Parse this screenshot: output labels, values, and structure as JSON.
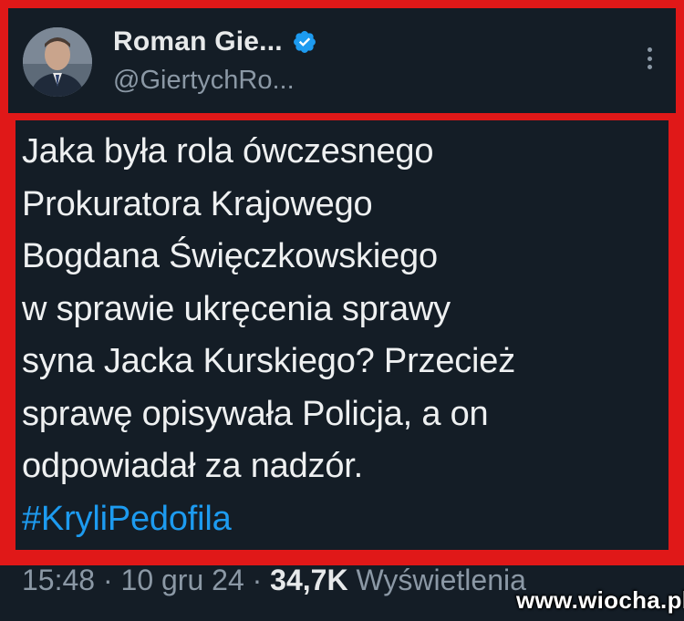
{
  "author": {
    "display_name": "Roman Gie...",
    "handle": "@GiertychRo...",
    "verified_icon": "verified-badge-icon",
    "avatar_icon": "profile-photo"
  },
  "tweet": {
    "lines": [
      "Jaka była rola ówczesnego",
      "Prokuratora Krajowego",
      "Bogdana Święczkowskiego",
      "w sprawie ukręcenia sprawy",
      "syna Jacka Kurskiego? Przecież",
      "sprawę opisywała Policja, a on",
      "odpowiadał za nadzór."
    ],
    "hashtag": "#KryliPedofila"
  },
  "meta": {
    "time": "15:48",
    "separator1": " · ",
    "date": "10 gru 24",
    "separator2": " · ",
    "views_count": "34,7K",
    "views_label": " Wyświetlenia"
  },
  "watermark": "www.wiocha.pl",
  "colors": {
    "background": "#141d26",
    "frame": "#e01818",
    "hashtag": "#1d9bf0",
    "secondary_text": "#8b98a5",
    "verified": "#1d9bf0"
  }
}
